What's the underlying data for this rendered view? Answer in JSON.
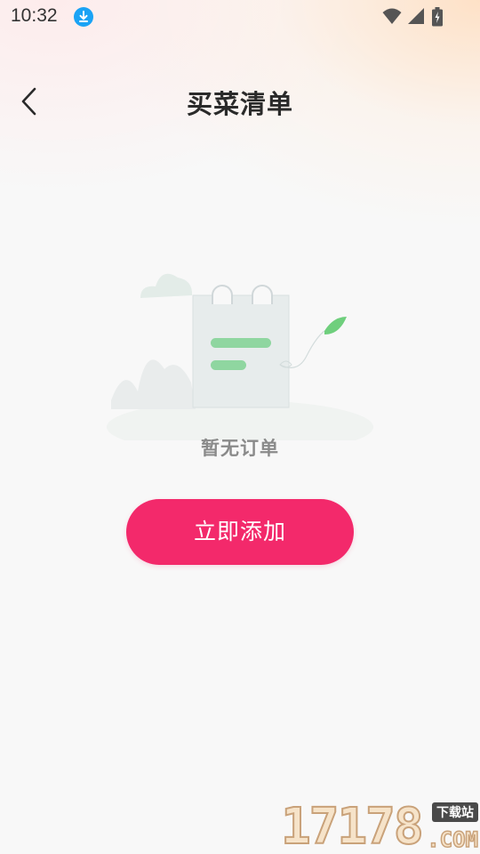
{
  "status_bar": {
    "time": "10:32",
    "download_icon": "download-icon",
    "wifi_icon": "wifi-icon",
    "signal_icon": "signal-icon",
    "battery_icon": "battery-charging-icon"
  },
  "header": {
    "title": "买菜清单",
    "back_icon": "chevron-left-icon"
  },
  "empty_state": {
    "illustration_icon": "empty-notepad-illustration",
    "message": "暂无订单"
  },
  "action": {
    "add_label": "立即添加",
    "color": "#f3296b"
  },
  "watermark": {
    "digits": "17178",
    "tag": "下载站",
    "suffix": ".COM"
  },
  "colors": {
    "accent": "#f3296b",
    "title": "#2a2a2a",
    "muted": "#8a8a8a",
    "download_badge": "#1aa3f5"
  }
}
